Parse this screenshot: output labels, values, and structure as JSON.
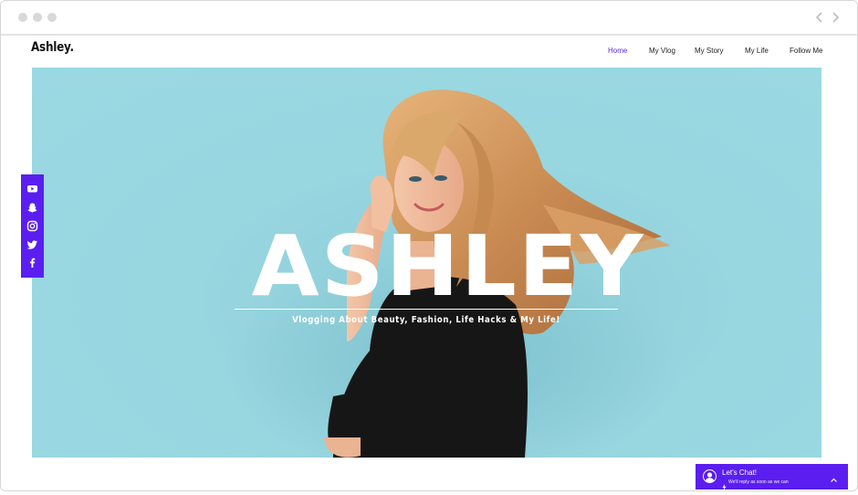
{
  "site": {
    "logo": "Ashley.",
    "nav": [
      {
        "label": "Home",
        "active": true
      },
      {
        "label": "My Vlog",
        "active": false
      },
      {
        "label": "My Story",
        "active": false
      },
      {
        "label": "My Life",
        "active": false
      },
      {
        "label": "Follow Me",
        "active": false
      }
    ]
  },
  "hero": {
    "title": "ASHLEY",
    "subtitle": "Vlogging About Beauty, Fashion, Life Hacks & My Life!"
  },
  "social": {
    "icons": [
      "youtube-icon",
      "snapchat-icon",
      "instagram-icon",
      "twitter-icon",
      "facebook-icon"
    ]
  },
  "chat": {
    "title": "Let's Chat!",
    "subtitle": "We'll reply as soon as we can"
  },
  "colors": {
    "accent": "#5b1ef0",
    "hero_bg": "#9ad9e3",
    "active_nav": "#5b2be3"
  }
}
